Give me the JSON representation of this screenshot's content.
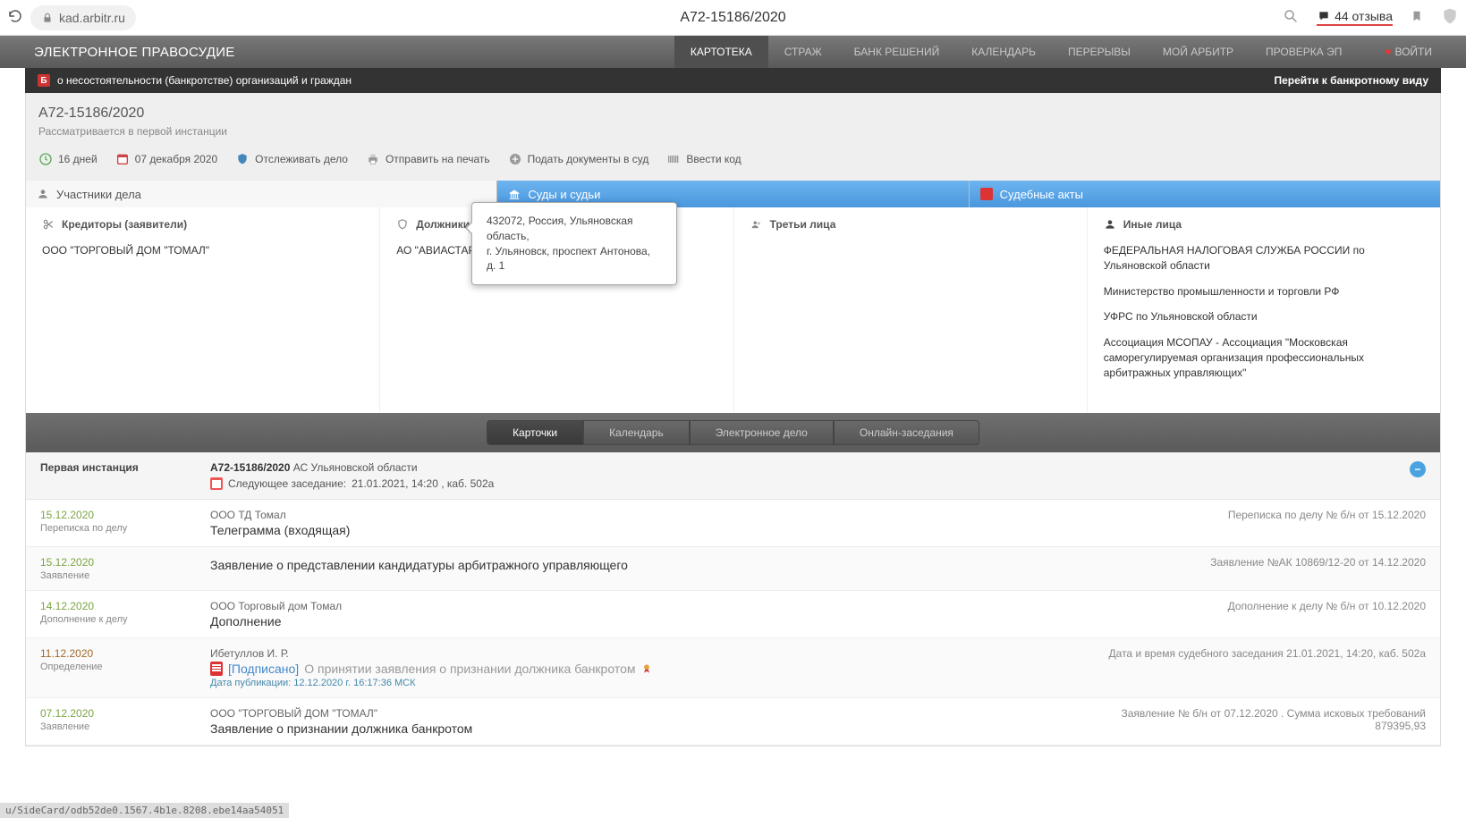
{
  "browser": {
    "url": "kad.arbitr.ru",
    "title": "А72-15186/2020",
    "reviews": "44 отзыва"
  },
  "topnav": {
    "brand": "ЭЛЕКТРОННОЕ ПРАВОСУДИЕ",
    "items": [
      "КАРТОТЕКА",
      "СТРАЖ",
      "БАНК РЕШЕНИЙ",
      "КАЛЕНДАРЬ",
      "ПЕРЕРЫВЫ",
      "МОЙ АРБИТР",
      "ПРОВЕРКА ЭП"
    ],
    "login": "ВОЙТИ"
  },
  "bk_bar": {
    "left": "о несостоятельности (банкротстве) организаций и граждан",
    "right": "Перейти к банкротному виду"
  },
  "case": {
    "number": "А72-15186/2020",
    "status": "Рассматривается в первой инстанции",
    "days": "16 дней",
    "reg_date": "07 декабря 2020",
    "tools": {
      "watch": "Отслеживать дело",
      "print": "Отправить на печать",
      "submit": "Подать документы в суд",
      "code": "Ввести код"
    }
  },
  "seg_tabs": {
    "participants": "Участники дела",
    "courts": "Суды и судьи",
    "acts": "Судебные акты"
  },
  "participants": {
    "creditors": {
      "title": "Кредиторы (заявители)",
      "items": [
        "ООО \"ТОРГОВЫЙ ДОМ \"ТОМАЛ\""
      ]
    },
    "debtors": {
      "title": "Должники",
      "items": [
        "АО \"АВИАСТАР-СП\""
      ]
    },
    "third": {
      "title": "Третьи лица",
      "items": []
    },
    "other": {
      "title": "Иные лица",
      "items": [
        "ФЕДЕРАЛЬНАЯ НАЛОГОВАЯ СЛУЖБА РОССИИ по Ульяновской области",
        "Министерство промышленности и торговли РФ",
        "УФРС по Ульяновской области",
        "Ассоциация МСОПАУ - Ассоциация \"Московская саморегулируемая организация профессиональных арбитражных управляющих\""
      ]
    }
  },
  "tooltip": {
    "line1": "432072, Россия, Ульяновская область,",
    "line2": "г. Ульяновск, проспект Антонова, д. 1"
  },
  "sec_toggle": [
    "Карточки",
    "Календарь",
    "Электронное дело",
    "Онлайн-заседания"
  ],
  "instance": {
    "label": "Первая инстанция",
    "case_no": "А72-15186/2020",
    "court": "АС Ульяновской области",
    "next_label": "Следующее заседание:",
    "next_value": "21.01.2021, 14:20 , каб. 502а"
  },
  "docs": [
    {
      "date": "15.12.2020",
      "type": "Переписка по делу",
      "who": "ООО ТД Томал",
      "title": "Телеграмма (входящая)",
      "right": "Переписка по делу № б/н от 15.12.2020"
    },
    {
      "date": "15.12.2020",
      "type": "Заявление",
      "who": "",
      "title": "Заявление о представлении кандидатуры арбитражного управляющего",
      "right": "Заявление №АК 10869/12-20 от 14.12.2020"
    },
    {
      "date": "14.12.2020",
      "type": "Дополнение к делу",
      "who": "ООО Торговый дом Томал",
      "title": "Дополнение",
      "right": "Дополнение к делу № б/н от 10.12.2020"
    },
    {
      "date": "11.12.2020",
      "type": "Определение",
      "date_color": "brown",
      "who": "Ибетуллов И. Р.",
      "signed": "[Подписано]",
      "title": "О принятии заявления о признании должника банкротом",
      "title_gray": true,
      "pdf": true,
      "award": true,
      "pubdate": "Дата публикации: 12.12.2020 г. 16:17:36 МСК",
      "right": "Дата и время судебного заседания 21.01.2021, 14:20, каб. 502а"
    },
    {
      "date": "07.12.2020",
      "type": "Заявление",
      "who": "ООО \"ТОРГОВЫЙ ДОМ \"ТОМАЛ\"",
      "title": "Заявление о признании должника банкротом",
      "right": "Заявление № б/н от 07.12.2020 . Сумма исковых требований 879395,93"
    }
  ],
  "status_footer": "u/SideCard/odb52de0.1567.4b1e.8208.ebe14aa54051"
}
